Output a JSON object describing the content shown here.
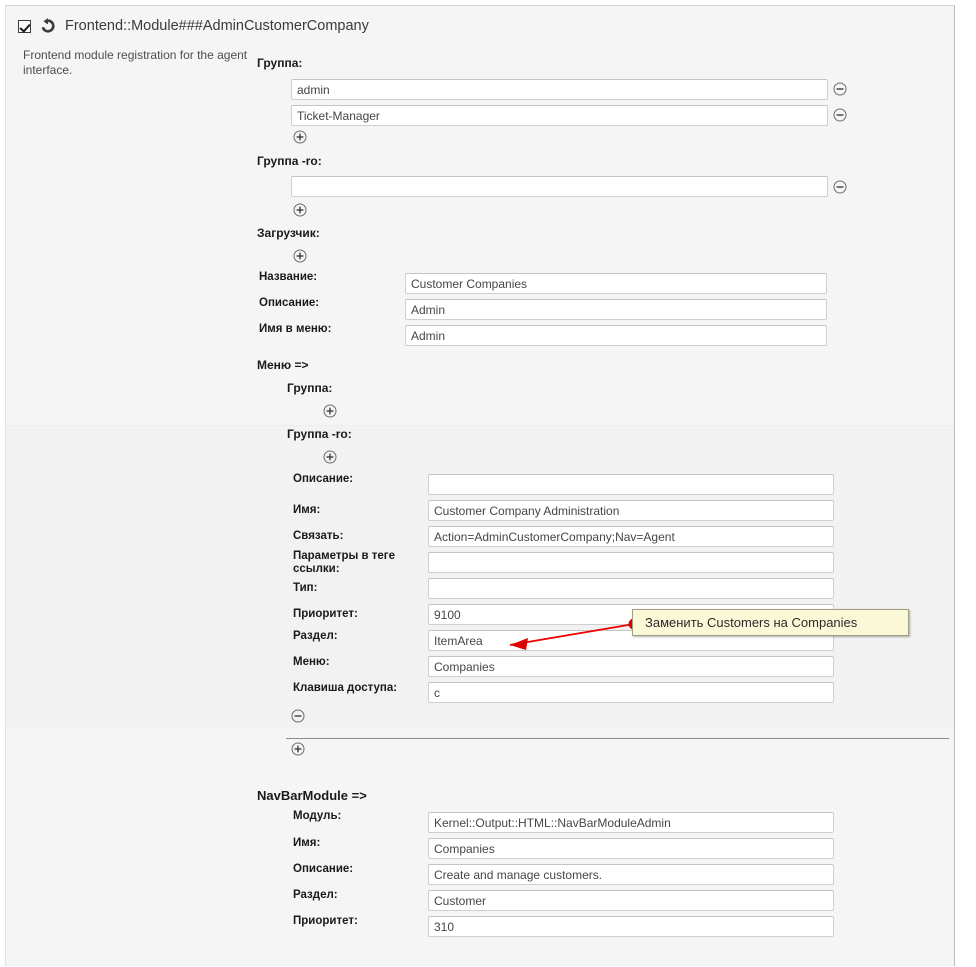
{
  "module": {
    "checkbox_checked": true,
    "reset_icon": "reset-circular-arrow-icon",
    "title": "Frontend::Module###AdminCustomerCompany",
    "description": "Frontend module registration for the agent interface."
  },
  "groups": {
    "group_label": "Группа:",
    "group_ro_label": "Группа -ro:",
    "loader_label": "Загрузчик:",
    "group_values": [
      "admin",
      "Ticket-Manager"
    ],
    "group_ro_values": [
      ""
    ],
    "add_icon": "add-circle-icon",
    "remove_icon": "remove-circle-icon"
  },
  "main_fields": [
    {
      "label": "Название:",
      "value": "Customer Companies"
    },
    {
      "label": "Описание:",
      "value": "Admin"
    },
    {
      "label": "Имя в меню:",
      "value": "Admin"
    }
  ],
  "menu_section": {
    "heading": "Меню =>",
    "group_label": "Группа:",
    "group_ro_label": "Группа -ro:",
    "fields": [
      {
        "label": "Описание:",
        "value": ""
      },
      {
        "label": "Имя:",
        "value": "Customer Company Administration"
      },
      {
        "label": "Связать:",
        "value": "Action=AdminCustomerCompany;Nav=Agent"
      },
      {
        "label": "Параметры в теге ссылки:",
        "value": ""
      },
      {
        "label": "Тип:",
        "value": ""
      },
      {
        "label": "Приоритет:",
        "value": "9100"
      },
      {
        "label": "Раздел:",
        "value": "ItemArea"
      },
      {
        "label": "Меню:",
        "value": "Companies"
      },
      {
        "label": "Клавиша доступа:",
        "value": "c"
      }
    ]
  },
  "navbar_section": {
    "heading": "NavBarModule =>",
    "fields": [
      {
        "label": "Модуль:",
        "value": "Kernel::Output::HTML::NavBarModuleAdmin"
      },
      {
        "label": "Имя:",
        "value": "Companies"
      },
      {
        "label": "Описание:",
        "value": "Create and manage customers."
      },
      {
        "label": "Раздел:",
        "value": "Customer"
      },
      {
        "label": "Приоритет:",
        "value": "310"
      }
    ]
  },
  "annotation": {
    "text": "Заменить Customers на Companies",
    "accent_color": "#ee0000",
    "background_color": "#fbf8d8"
  }
}
